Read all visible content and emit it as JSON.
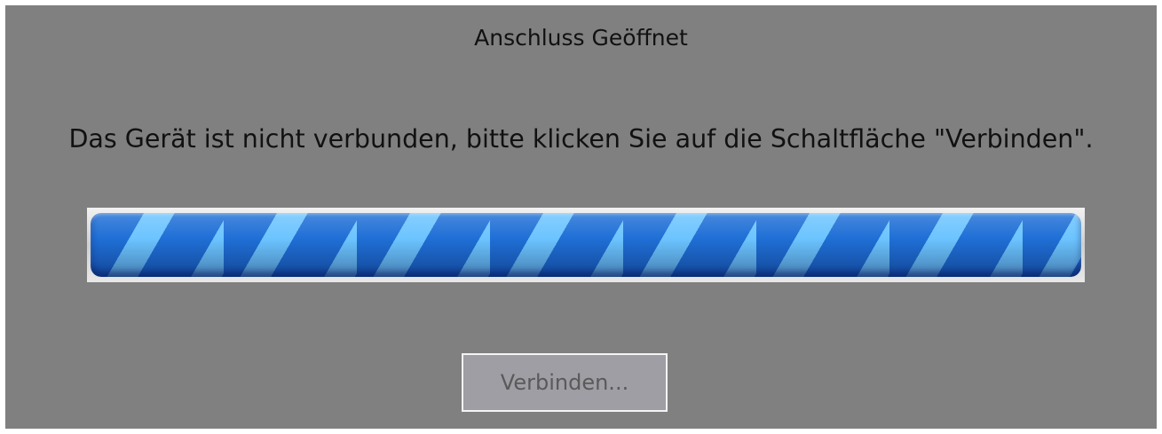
{
  "dialog": {
    "status_title": "Anschluss Geöffnet",
    "message": "Das Gerät ist nicht verbunden, bitte klicken Sie auf die Schaltfläche \"Verbinden\".",
    "progress": {
      "value_fraction": 1.0,
      "indeterminate": true,
      "stripe_colors": [
        "#1f6fd6",
        "#6cc4ff"
      ]
    },
    "connect_button_label": "Verbinden...",
    "background_color": "#808080"
  }
}
